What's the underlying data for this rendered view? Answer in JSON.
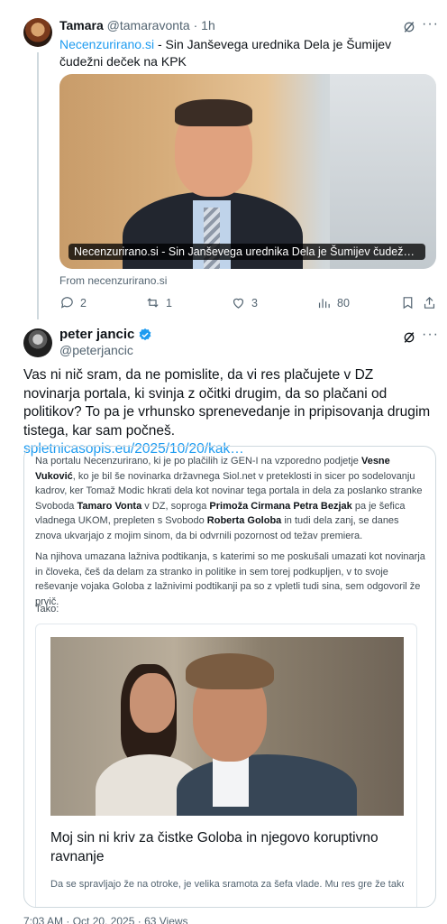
{
  "reply": {
    "name": "Tamara",
    "handle": "@tamaravonta",
    "time": "· 1h",
    "link_text": "Necenzurirano.si",
    "text": " - Sin Janševega urednika Dela je Šumijev čudežni deček na KPK",
    "media_caption": "Necenzurirano.si - Sin Janševega urednika Dela je Šumijev čudežni deček na K...",
    "from_text": "From necenzurirano.si",
    "stats": {
      "replies": "2",
      "reposts": "1",
      "likes": "3",
      "views": "80"
    }
  },
  "main": {
    "name": "peter jancic",
    "handle": "@peterjancic",
    "text": "Vas ni nič sram, da ne pomislite, da vi res plačujete v DZ  novinarja portala, ki svinja  z očitki drugim, da so plačani od politikov? To pa je vrhunsko sprenevedanje in pripisovanja drugim tistega, kar sam počneš.",
    "link_text": "spletnicasopis.eu/2025/10/20/kak…",
    "quote": {
      "p1": {
        "t1": "Na portalu Necenzurirano, ki je po plačilih iz GEN-I na vzporedno podjetje ",
        "b1": "Vesne Vuković",
        "t2": ", ko je bil še novinarka državnega Siol.net v preteklosti in sicer po sodelovanju kadrov, ker Tomaž Modic hkrati dela kot novinar tega portala in dela za poslanko stranke Svoboda ",
        "b2": "Tamaro Vonta",
        "t3": " v DZ, soproga ",
        "b3": "Primoža Cirmana Petra Bezjak",
        "t4": " pa je šefica vladnega UKOM, prepleten s Svobodo ",
        "b4": "Roberta Goloba",
        "t5": " in tudi dela zanj, se danes znova ukvarjajo z mojim sinom, da bi odvrnili pozornost od težav premiera."
      },
      "p2": "Na njihova umazana lažniva podtikanja, s katerimi so me poskušali umazati kot novinarja in človeka, češ da delam za stranko in politike in sem torej podkupljen, v to svoje reševanje vojaka Goloba z lažnivimi podtikanji pa so z vpletli tudi sina, sem odgovoril že prvič.",
      "p3": "Tako:",
      "card_title": "Moj sin ni kriv za čistke Goloba in njegovo koruptivno ravnanje",
      "card_desc": "Da se spravljajo že na otroke, je velika sramota za šefa vlade. Mu res gre že tako slabo?"
    },
    "footer_stub": "7:03 AM · Oct 20, 2025 · 63 Views"
  },
  "colors": {
    "accent": "#1d9bf0",
    "muted": "#536471",
    "border": "#cfd9de"
  }
}
